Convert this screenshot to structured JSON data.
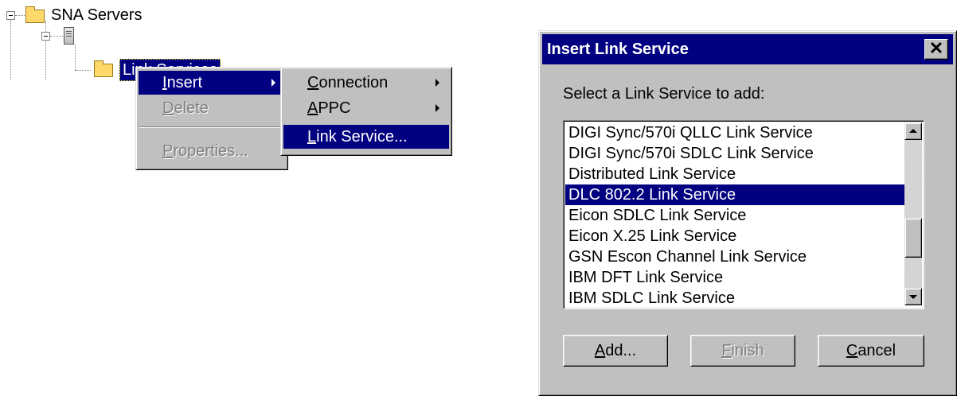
{
  "tree": {
    "root_label": "SNA Servers",
    "child_label": "Link Services"
  },
  "context_menu": {
    "items": [
      {
        "label": "Insert",
        "accel": "I",
        "state": "selected",
        "submenu": true
      },
      {
        "label": "Delete",
        "accel": "D",
        "state": "disabled"
      },
      {
        "label": "Properties...",
        "accel": "P",
        "state": "disabled"
      }
    ]
  },
  "submenu": {
    "items": [
      {
        "label": "Connection",
        "accel": "C",
        "submenu": true
      },
      {
        "label": "APPC",
        "accel": "A",
        "submenu": true
      },
      {
        "label": "Link Service...",
        "accel": "L",
        "state": "selected"
      }
    ]
  },
  "dialog": {
    "title": "Insert Link Service",
    "close_glyph": "✕",
    "prompt": "Select a Link Service to add:",
    "list_items": [
      "DIGI Sync/570i QLLC Link Service",
      "DIGI Sync/570i SDLC Link Service",
      "Distributed Link Service",
      "DLC 802.2 Link Service",
      "Eicon SDLC Link Service",
      "Eicon X.25 Link Service",
      "GSN Escon Channel Link Service",
      "IBM DFT Link Service",
      "IBM SDLC Link Service"
    ],
    "selected_item": "DLC 802.2 Link Service",
    "scroll_position_fraction": 0.72,
    "buttons": {
      "add": {
        "label": "Add...",
        "accel": "A",
        "enabled": true
      },
      "finish": {
        "label": "Finish",
        "accel": "F",
        "enabled": false
      },
      "cancel": {
        "label": "Cancel",
        "accel": "C",
        "enabled": true
      }
    }
  },
  "colors": {
    "face": "#c0c0c0",
    "highlight": "#000080",
    "disabled_text": "#808080",
    "folder": "#ffd86b"
  }
}
